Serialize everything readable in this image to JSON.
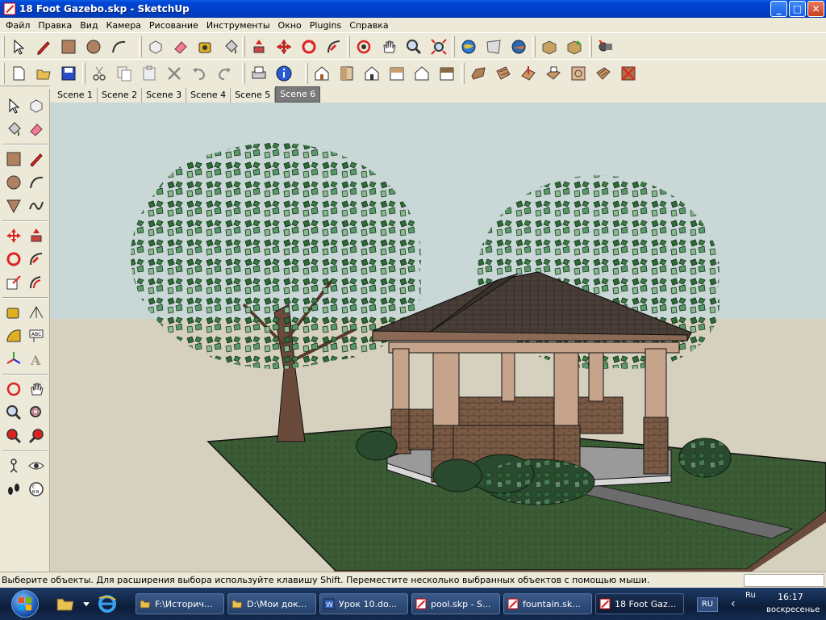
{
  "window": {
    "title": "18 Foot Gazebo.skp - SketchUp",
    "minimize": "_",
    "maximize": "□",
    "close": "✕"
  },
  "menu": [
    "Файл",
    "Правка",
    "Вид",
    "Камера",
    "Рисование",
    "Инструменты",
    "Окно",
    "Plugins",
    "Справка"
  ],
  "scenes": {
    "tabs": [
      "Scene 1",
      "Scene 2",
      "Scene 3",
      "Scene 4",
      "Scene 5",
      "Scene 6"
    ],
    "active": "Scene 6"
  },
  "status": {
    "text": "Выберите объекты. Для расширения выбора используйте клавишу Shift. Переместите несколько выбранных объектов с помощью мыши."
  },
  "taskbar": {
    "tasks": [
      {
        "label": "F:\\Историч...",
        "icon": "folder-icon"
      },
      {
        "label": "D:\\Мои док...",
        "icon": "folder-icon"
      },
      {
        "label": "Урок 10.do...",
        "icon": "word-icon"
      },
      {
        "label": "pool.skp - S...",
        "icon": "sketchup-icon"
      },
      {
        "label": "fountain.sk...",
        "icon": "sketchup-icon"
      },
      {
        "label": "18 Foot Gaz...",
        "icon": "sketchup-icon"
      }
    ],
    "active_task": "18 Foot Gaz...",
    "lang": "RU",
    "tray_lang": "Ru",
    "time": "16:17",
    "day": "воскресенье"
  },
  "colors": {
    "sky": "#c9d8d6",
    "ground": "#d6d1bf",
    "grass": "#3a5a34",
    "accent_title": "#0046d5"
  }
}
